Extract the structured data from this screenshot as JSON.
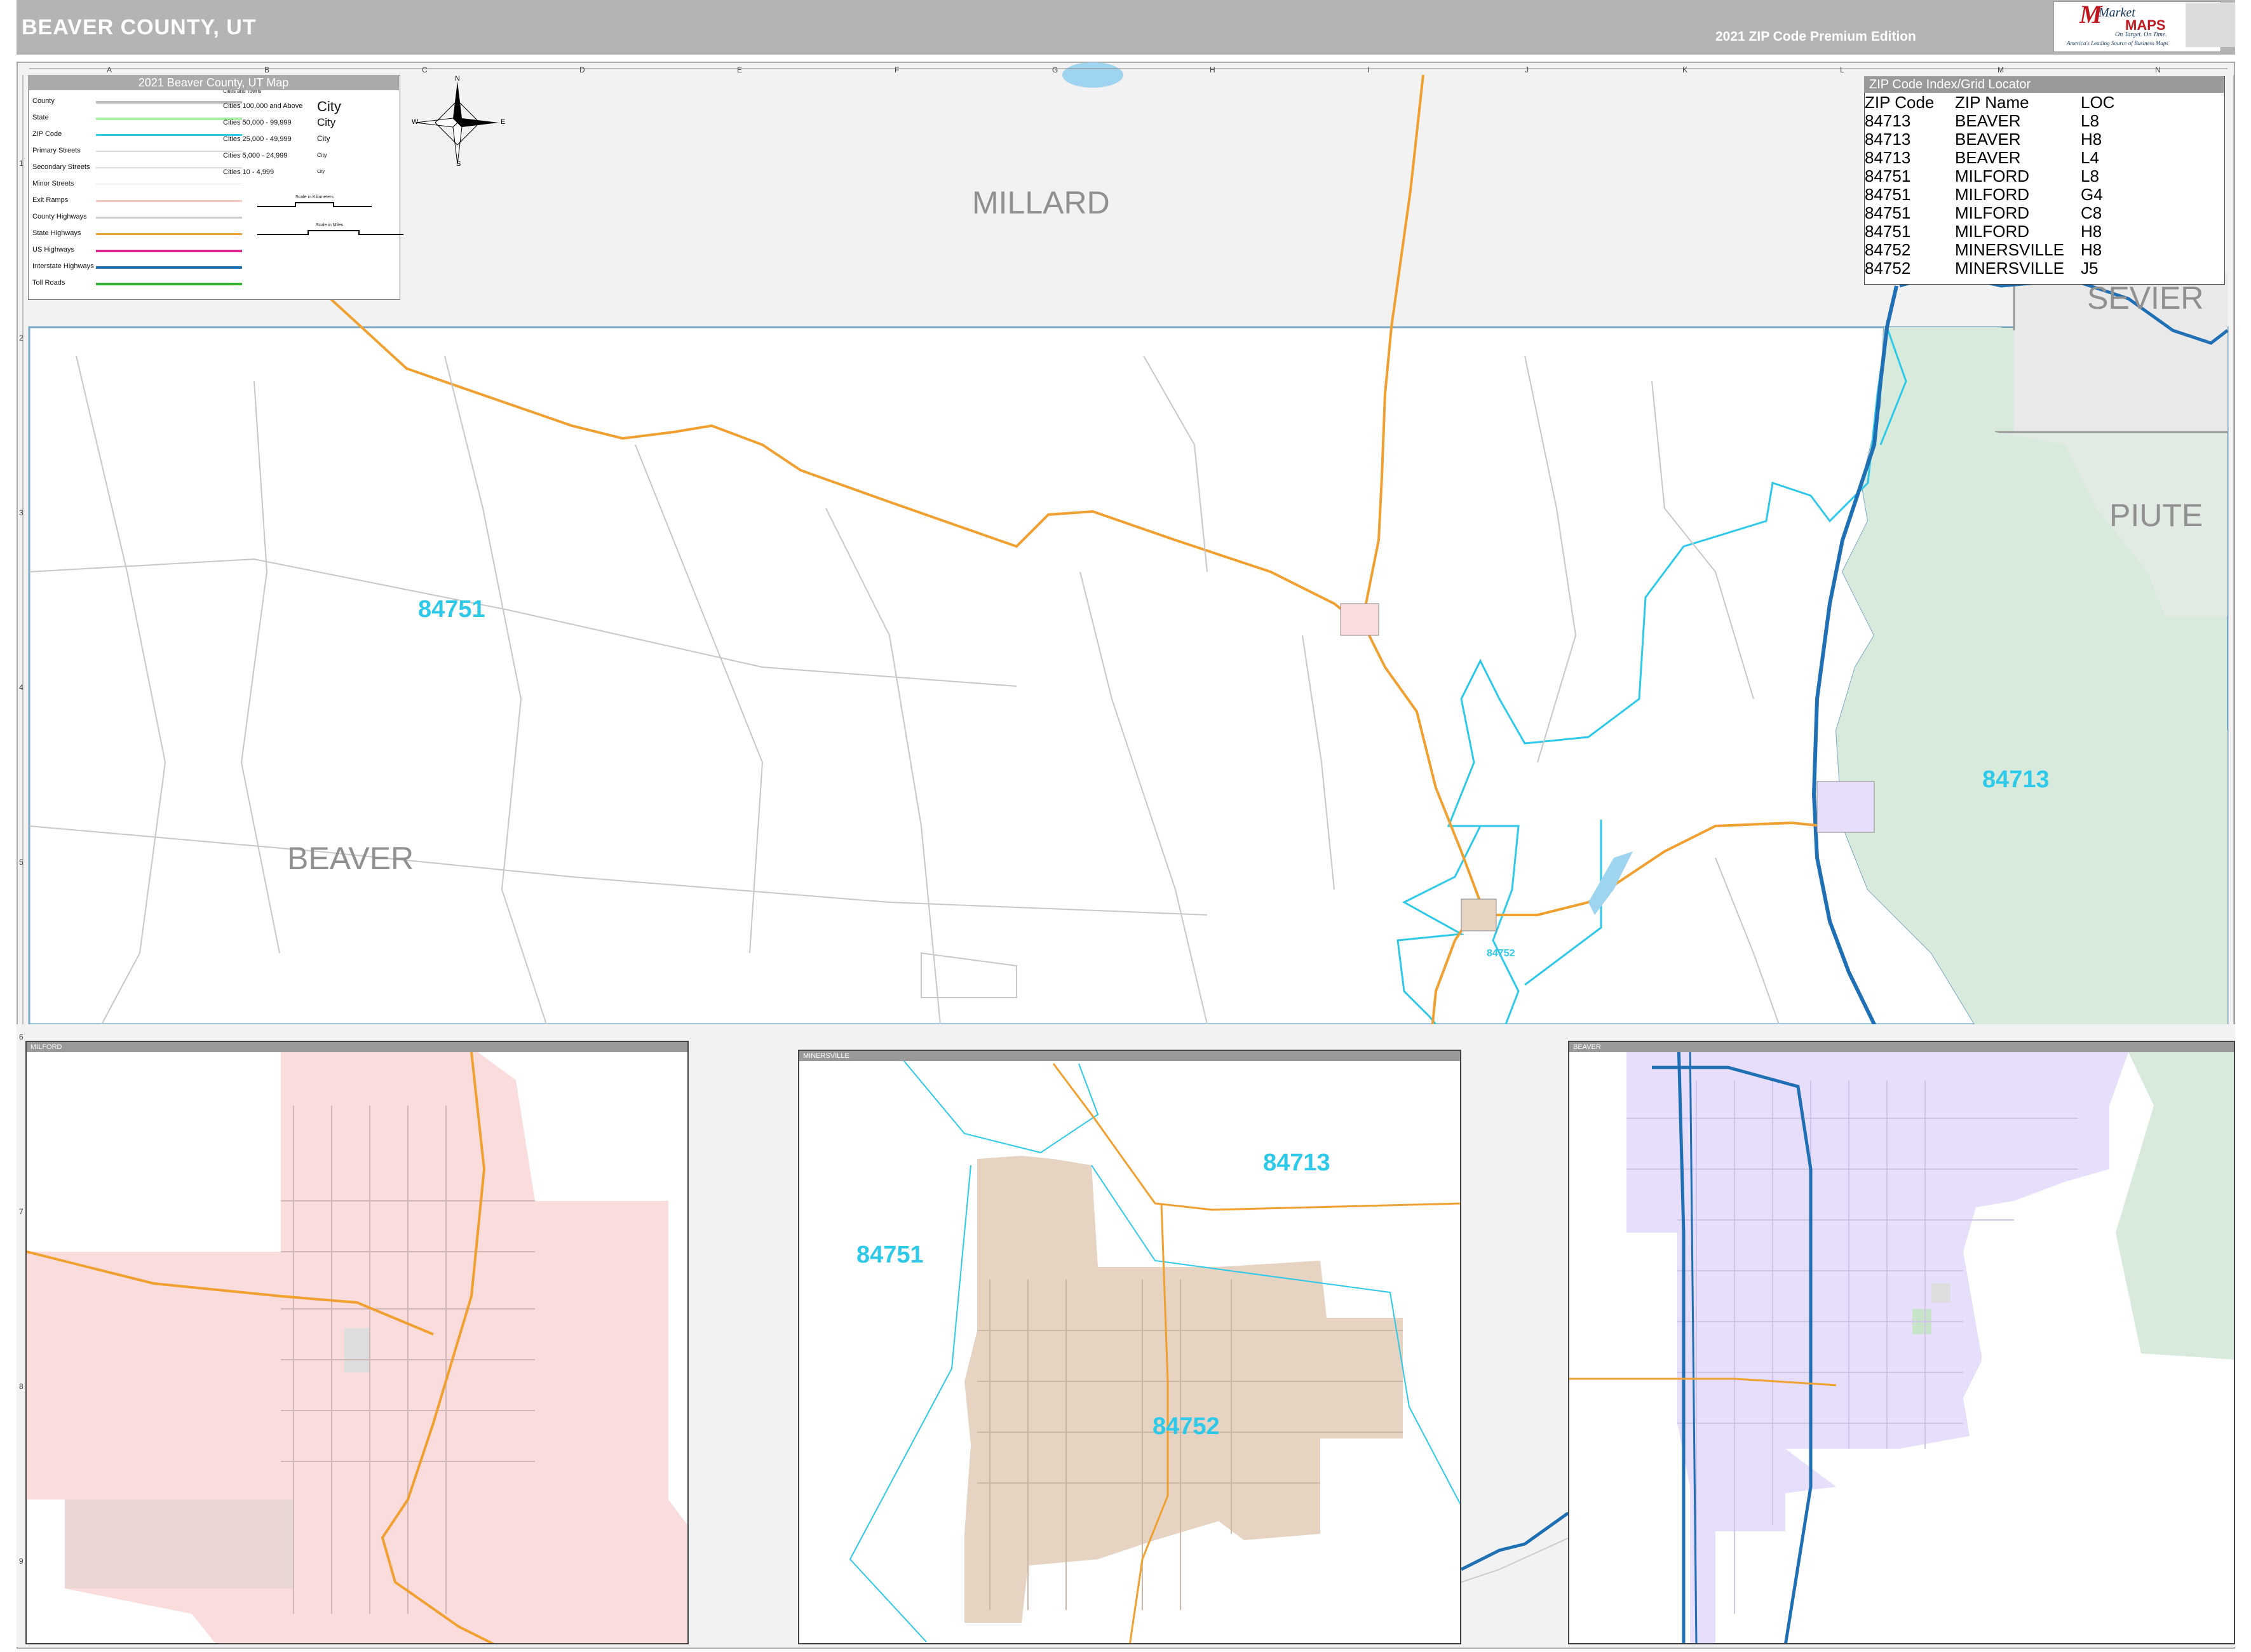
{
  "header": {
    "title": "BEAVER COUNTY, UT",
    "edition": "2021 ZIP Code Premium Edition",
    "logo_market": "Market",
    "logo_maps": "MAPS",
    "logo_tagline": "On Target. On Time.",
    "logo_subtitle": "America's Leading Source of Business Maps"
  },
  "grid": {
    "columns": [
      "A",
      "B",
      "C",
      "D",
      "E",
      "F",
      "G",
      "H",
      "I",
      "J",
      "K",
      "L",
      "M",
      "N"
    ],
    "rows": [
      "1",
      "2",
      "3",
      "4",
      "5",
      "6",
      "7",
      "8",
      "9"
    ]
  },
  "legend": {
    "title": "2021 Beaver County, UT Map",
    "road_items": [
      "County",
      "State",
      "ZIP Code",
      "Primary Streets",
      "Secondary Streets",
      "Minor Streets",
      "Exit Ramps",
      "County Highways",
      "State Highways",
      "US Highways",
      "Interstate Highways",
      "Toll Roads"
    ],
    "cities_title": "Cities and Towns",
    "city_items": [
      "Cities 100,000 and Above",
      "Cities 50,000 - 99,999",
      "Cities 25,000 - 49,999",
      "Cities 5,000 - 24,999",
      "Cities 10 - 4,999"
    ],
    "city_samples": [
      "City",
      "City",
      "City",
      "City",
      "City"
    ],
    "scale_km": "Scale in Kilometers",
    "scale_mi": "Scale in Miles",
    "compass": {
      "n": "N",
      "s": "S",
      "e": "E",
      "w": "W"
    }
  },
  "zip_index": {
    "title": "ZIP Code Index/Grid Locator",
    "headers": [
      "ZIP Code",
      "ZIP Name",
      "LOC"
    ],
    "rows": [
      [
        "84713",
        "BEAVER",
        "L8"
      ],
      [
        "84713",
        "BEAVER",
        "H8"
      ],
      [
        "84713",
        "BEAVER",
        "L4"
      ],
      [
        "84751",
        "MILFORD",
        "L8"
      ],
      [
        "84751",
        "MILFORD",
        "G4"
      ],
      [
        "84751",
        "MILFORD",
        "C8"
      ],
      [
        "84751",
        "MILFORD",
        "H8"
      ],
      [
        "84752",
        "MINERSVILLE",
        "H8"
      ],
      [
        "84752",
        "MINERSVILLE",
        "J5"
      ]
    ]
  },
  "counties": {
    "millard": "MILLARD",
    "sevier": "SEVIER",
    "piute": "PIUTE",
    "beaver": "BEAVER"
  },
  "zips_main": {
    "z84751": "84751",
    "z84713": "84713",
    "z84752": "84752"
  },
  "insets": {
    "milford": {
      "title": "MILFORD"
    },
    "minersville": {
      "title": "MINERSVILLE",
      "z1": "84713",
      "z2": "84751",
      "z3": "84752"
    },
    "beaver": {
      "title": "BEAVER"
    }
  },
  "colors": {
    "header_gray": "#b4b4b4",
    "zip_boundary": "#2ec9e8",
    "state_highway": "#f0a030",
    "interstate": "#1f6fb5",
    "forest": "#d7eadc",
    "milford_fill": "#fbdcdc",
    "minersville_fill": "#e6d3c2",
    "beaver_fill": "#e6defa"
  }
}
